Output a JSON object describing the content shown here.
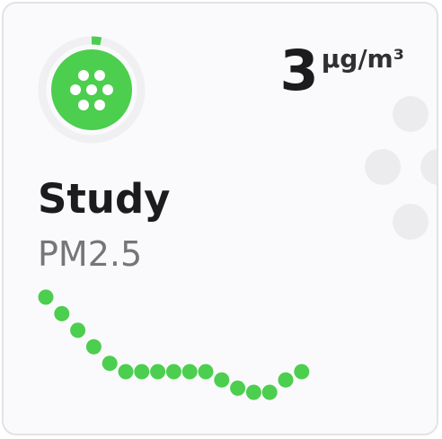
{
  "sensor": {
    "name": "Study",
    "metric": "PM2.5",
    "value": "3",
    "unit": "µg/m³",
    "accent_color": "#4cce4e",
    "ring_track_color": "#f0f0f3",
    "ring_progress_fraction": 0.03,
    "icon": "air-particles-icon"
  },
  "history": {
    "color": "#4cce4e",
    "values": [
      15,
      13,
      11,
      9,
      7,
      6,
      6,
      6,
      6,
      6,
      6,
      5,
      4,
      3.5,
      3.5,
      5,
      6
    ]
  }
}
